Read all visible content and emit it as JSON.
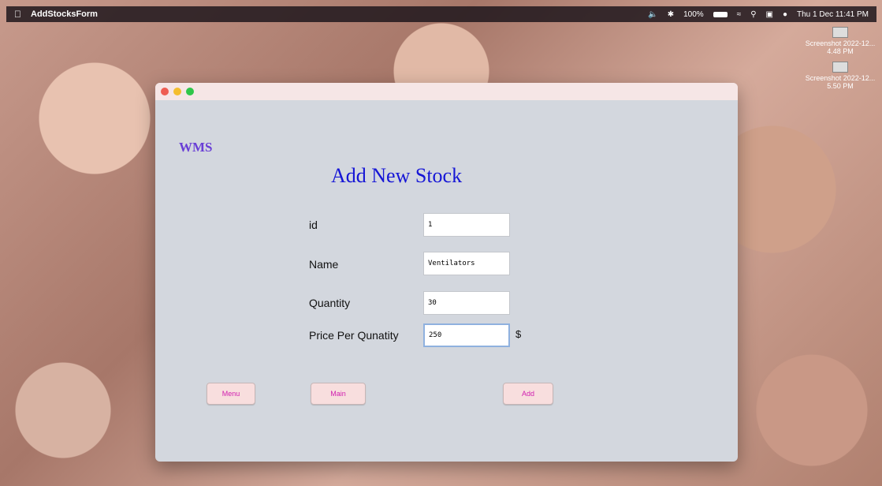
{
  "menubar": {
    "app_name": "AddStocksForm",
    "battery": "100%",
    "clock": "Thu 1 Dec  11:41 PM"
  },
  "desktop": {
    "icons": [
      {
        "label": "Screenshot 2022-12... 4.48 PM"
      },
      {
        "label": "Screenshot 2022-12... 5.50 PM"
      }
    ]
  },
  "window": {
    "brand": "WMS",
    "heading": "Add New Stock",
    "form": {
      "id_label": "id",
      "id_value": "1",
      "name_label": "Name",
      "name_value": "Ventilators",
      "quantity_label": "Quantity",
      "quantity_value": "30",
      "price_label": "Price Per Qunatity",
      "price_value": "250",
      "currency": "$"
    },
    "buttons": {
      "menu": "Menu",
      "main": "Main",
      "add": "Add"
    }
  },
  "colors": {
    "brand": "#6a3fd6",
    "heading": "#1616d6",
    "button_text": "#d020b0",
    "button_bg": "#f8dede",
    "window_bg": "#d3d7de"
  }
}
